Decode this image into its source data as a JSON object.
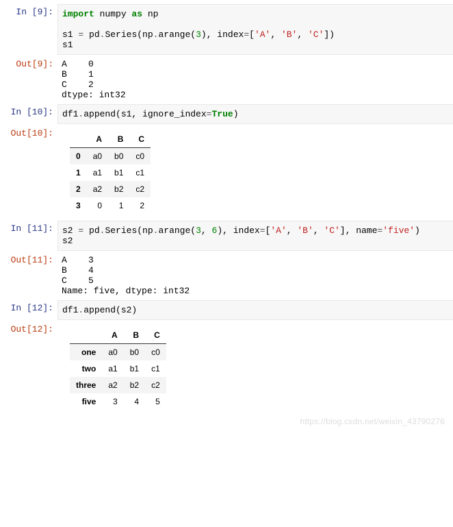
{
  "prompts": {
    "in9": "In  [9]:",
    "out9": "Out[9]:",
    "in10": "In  [10]:",
    "out10": "Out[10]:",
    "in11": "In  [11]:",
    "out11": "Out[11]:",
    "in12": "In  [12]:",
    "out12": "Out[12]:"
  },
  "code9": {
    "l1": {
      "a": "import",
      "b": " numpy ",
      "c": "as",
      "d": " np"
    },
    "gap": "",
    "l2": {
      "a": "s1 ",
      "eq": "=",
      "b": " pd",
      "dot": ".",
      "c": "Series(np",
      "dot2": ".",
      "d": "arange(",
      "n": "3",
      "e": "), index",
      "eq2": "=",
      "f": "[",
      "s1": "'A'",
      "g": ", ",
      "s2": "'B'",
      "h": ", ",
      "s3": "'C'",
      "i": "])"
    },
    "l3": "s1"
  },
  "out9_text": "A    0\nB    1\nC    2\ndtype: int32",
  "code10": {
    "a": "df1",
    "dot": ".",
    "b": "append(s1, ignore_index",
    "eq": "=",
    "c": "True",
    "d": ")"
  },
  "table10": {
    "cols": [
      "A",
      "B",
      "C"
    ],
    "rows": [
      {
        "idx": "0",
        "vals": [
          "a0",
          "b0",
          "c0"
        ]
      },
      {
        "idx": "1",
        "vals": [
          "a1",
          "b1",
          "c1"
        ]
      },
      {
        "idx": "2",
        "vals": [
          "a2",
          "b2",
          "c2"
        ]
      },
      {
        "idx": "3",
        "vals": [
          "0",
          "1",
          "2"
        ]
      }
    ]
  },
  "code11": {
    "a": "s2 ",
    "eq": "=",
    "b": " pd",
    "dot": ".",
    "c": "Series(np",
    "dot2": ".",
    "d": "arange(",
    "n1": "3",
    "e": ", ",
    "n2": "6",
    "f": "), index",
    "eq2": "=",
    "g": "[",
    "s1": "'A'",
    "h": ", ",
    "s2": "'B'",
    "i": ", ",
    "s3": "'C'",
    "j": "], name",
    "eq3": "=",
    "s4": "'five'",
    "k": ")",
    "l2": "s2"
  },
  "out11_text": "A    3\nB    4\nC    5\nName: five, dtype: int32",
  "code12": {
    "a": "df1",
    "dot": ".",
    "b": "append(s2)"
  },
  "table12": {
    "cols": [
      "A",
      "B",
      "C"
    ],
    "rows": [
      {
        "idx": "one",
        "vals": [
          "a0",
          "b0",
          "c0"
        ]
      },
      {
        "idx": "two",
        "vals": [
          "a1",
          "b1",
          "c1"
        ]
      },
      {
        "idx": "three",
        "vals": [
          "a2",
          "b2",
          "c2"
        ]
      },
      {
        "idx": "five",
        "vals": [
          "3",
          "4",
          "5"
        ]
      }
    ]
  },
  "watermark": "https://blog.csdn.net/weixin_43790276"
}
